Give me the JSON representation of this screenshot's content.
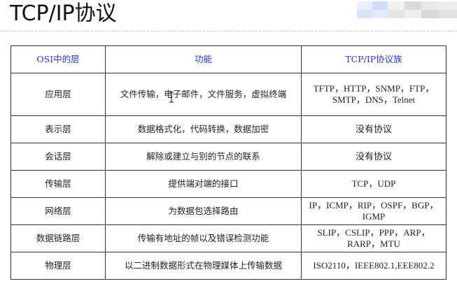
{
  "slide": {
    "title": "TCP/IP协议"
  },
  "colors": {
    "header_text": "#2a36c8",
    "border": "#333333",
    "logo_blue": "#dbe7fb"
  },
  "table": {
    "headers": [
      "OSI中的层",
      "功能",
      "TCP/IP协议族"
    ],
    "rows": [
      {
        "layer": "应用层",
        "function": "文件传输，电子邮件，文件服务，虚拟终端",
        "protocols": "TFTP，HTTP，SNMP，FTP，SMTP，DNS，Telnet"
      },
      {
        "layer": "表示层",
        "function": "数据格式化，代码转换，数据加密",
        "protocols": "没有协议"
      },
      {
        "layer": "会话层",
        "function": "解除或建立与别的节点的联系",
        "protocols": "没有协议"
      },
      {
        "layer": "传输层",
        "function": "提供端对端的接口",
        "protocols": "TCP，UDP"
      },
      {
        "layer": "网络层",
        "function": "为数据包选择路由",
        "protocols": "IP，ICMP，RIP，OSPF，BGP，IGMP"
      },
      {
        "layer": "数据链路层",
        "function": "传输有地址的帧以及错误检测功能",
        "protocols": "SLIP，CSLIP，PPP，ARP，RARP，MTU"
      },
      {
        "layer": "物理层",
        "function": "以二进制数据形式在物理媒体上传输数据",
        "protocols": "ISO2110，IEEE802.1,EEE802.2"
      }
    ]
  }
}
